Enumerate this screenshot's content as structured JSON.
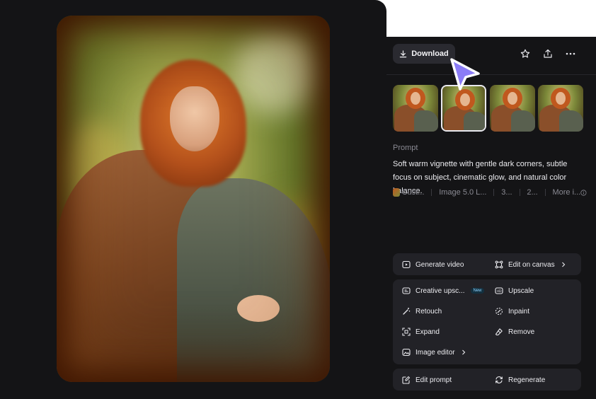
{
  "toolbar": {
    "download_label": "Download",
    "icons": [
      "download-icon",
      "star-icon",
      "share-icon",
      "more-icon"
    ]
  },
  "thumbnails": {
    "count": 4,
    "selected_index": 1
  },
  "prompt": {
    "label": "Prompt",
    "text": "Soft warm vignette with gentle dark corners, subtle focus on subject, cinematic glow, and natural color balance."
  },
  "meta": {
    "style": "Cust...",
    "model": "Image 5.0 L...",
    "ratio": "3...",
    "count": "2...",
    "more": "More i..."
  },
  "actions": {
    "generate_video": "Generate video",
    "edit_on_canvas": "Edit on canvas",
    "creative_upscale": "Creative upsc...",
    "new_badge": "New",
    "upscale": "Upscale",
    "retouch": "Retouch",
    "inpaint": "Inpaint",
    "expand": "Expand",
    "remove": "Remove",
    "image_editor": "Image editor",
    "edit_prompt": "Edit prompt",
    "regenerate": "Regenerate"
  },
  "colors": {
    "panel_bg": "#141416",
    "button_bg": "#2a2a30",
    "action_bg": "#222227",
    "cursor": "#8b7cf6",
    "new_badge": "#8fd3ff"
  }
}
